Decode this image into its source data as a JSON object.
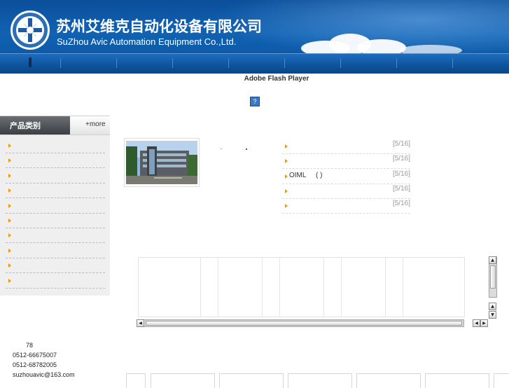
{
  "header": {
    "company_cn": "苏州艾维克自动化设备有限公司",
    "company_en": "SuZhou Avic Automation Equipment Co.,Ltd.",
    "logo_icon": "company-logo-icon"
  },
  "flash": {
    "label": "Adobe Flash Player",
    "icon_text": "?"
  },
  "sidebar": {
    "title": "产品类别",
    "more": "+more",
    "items": [
      "",
      "",
      "",
      "",
      "",
      "",
      "",
      "",
      "",
      ""
    ]
  },
  "news": {
    "items": [
      {
        "text": "",
        "date": "[5/16]"
      },
      {
        "text": "",
        "date": "[5/16]"
      },
      {
        "text": "OIML     ( )",
        "date": "[5/16]"
      },
      {
        "text": "",
        "date": "[5/16]"
      },
      {
        "text": "",
        "date": "[5/16]"
      }
    ]
  },
  "contact": {
    "line1": "78",
    "phone": "0512-66675007",
    "fax": "0512-68782005",
    "email": "suzhouavic@163.com"
  },
  "colors": {
    "header_blue": "#0d5aa8",
    "accent_orange": "#f09a00",
    "sidebar_dark": "#3b3f44"
  }
}
